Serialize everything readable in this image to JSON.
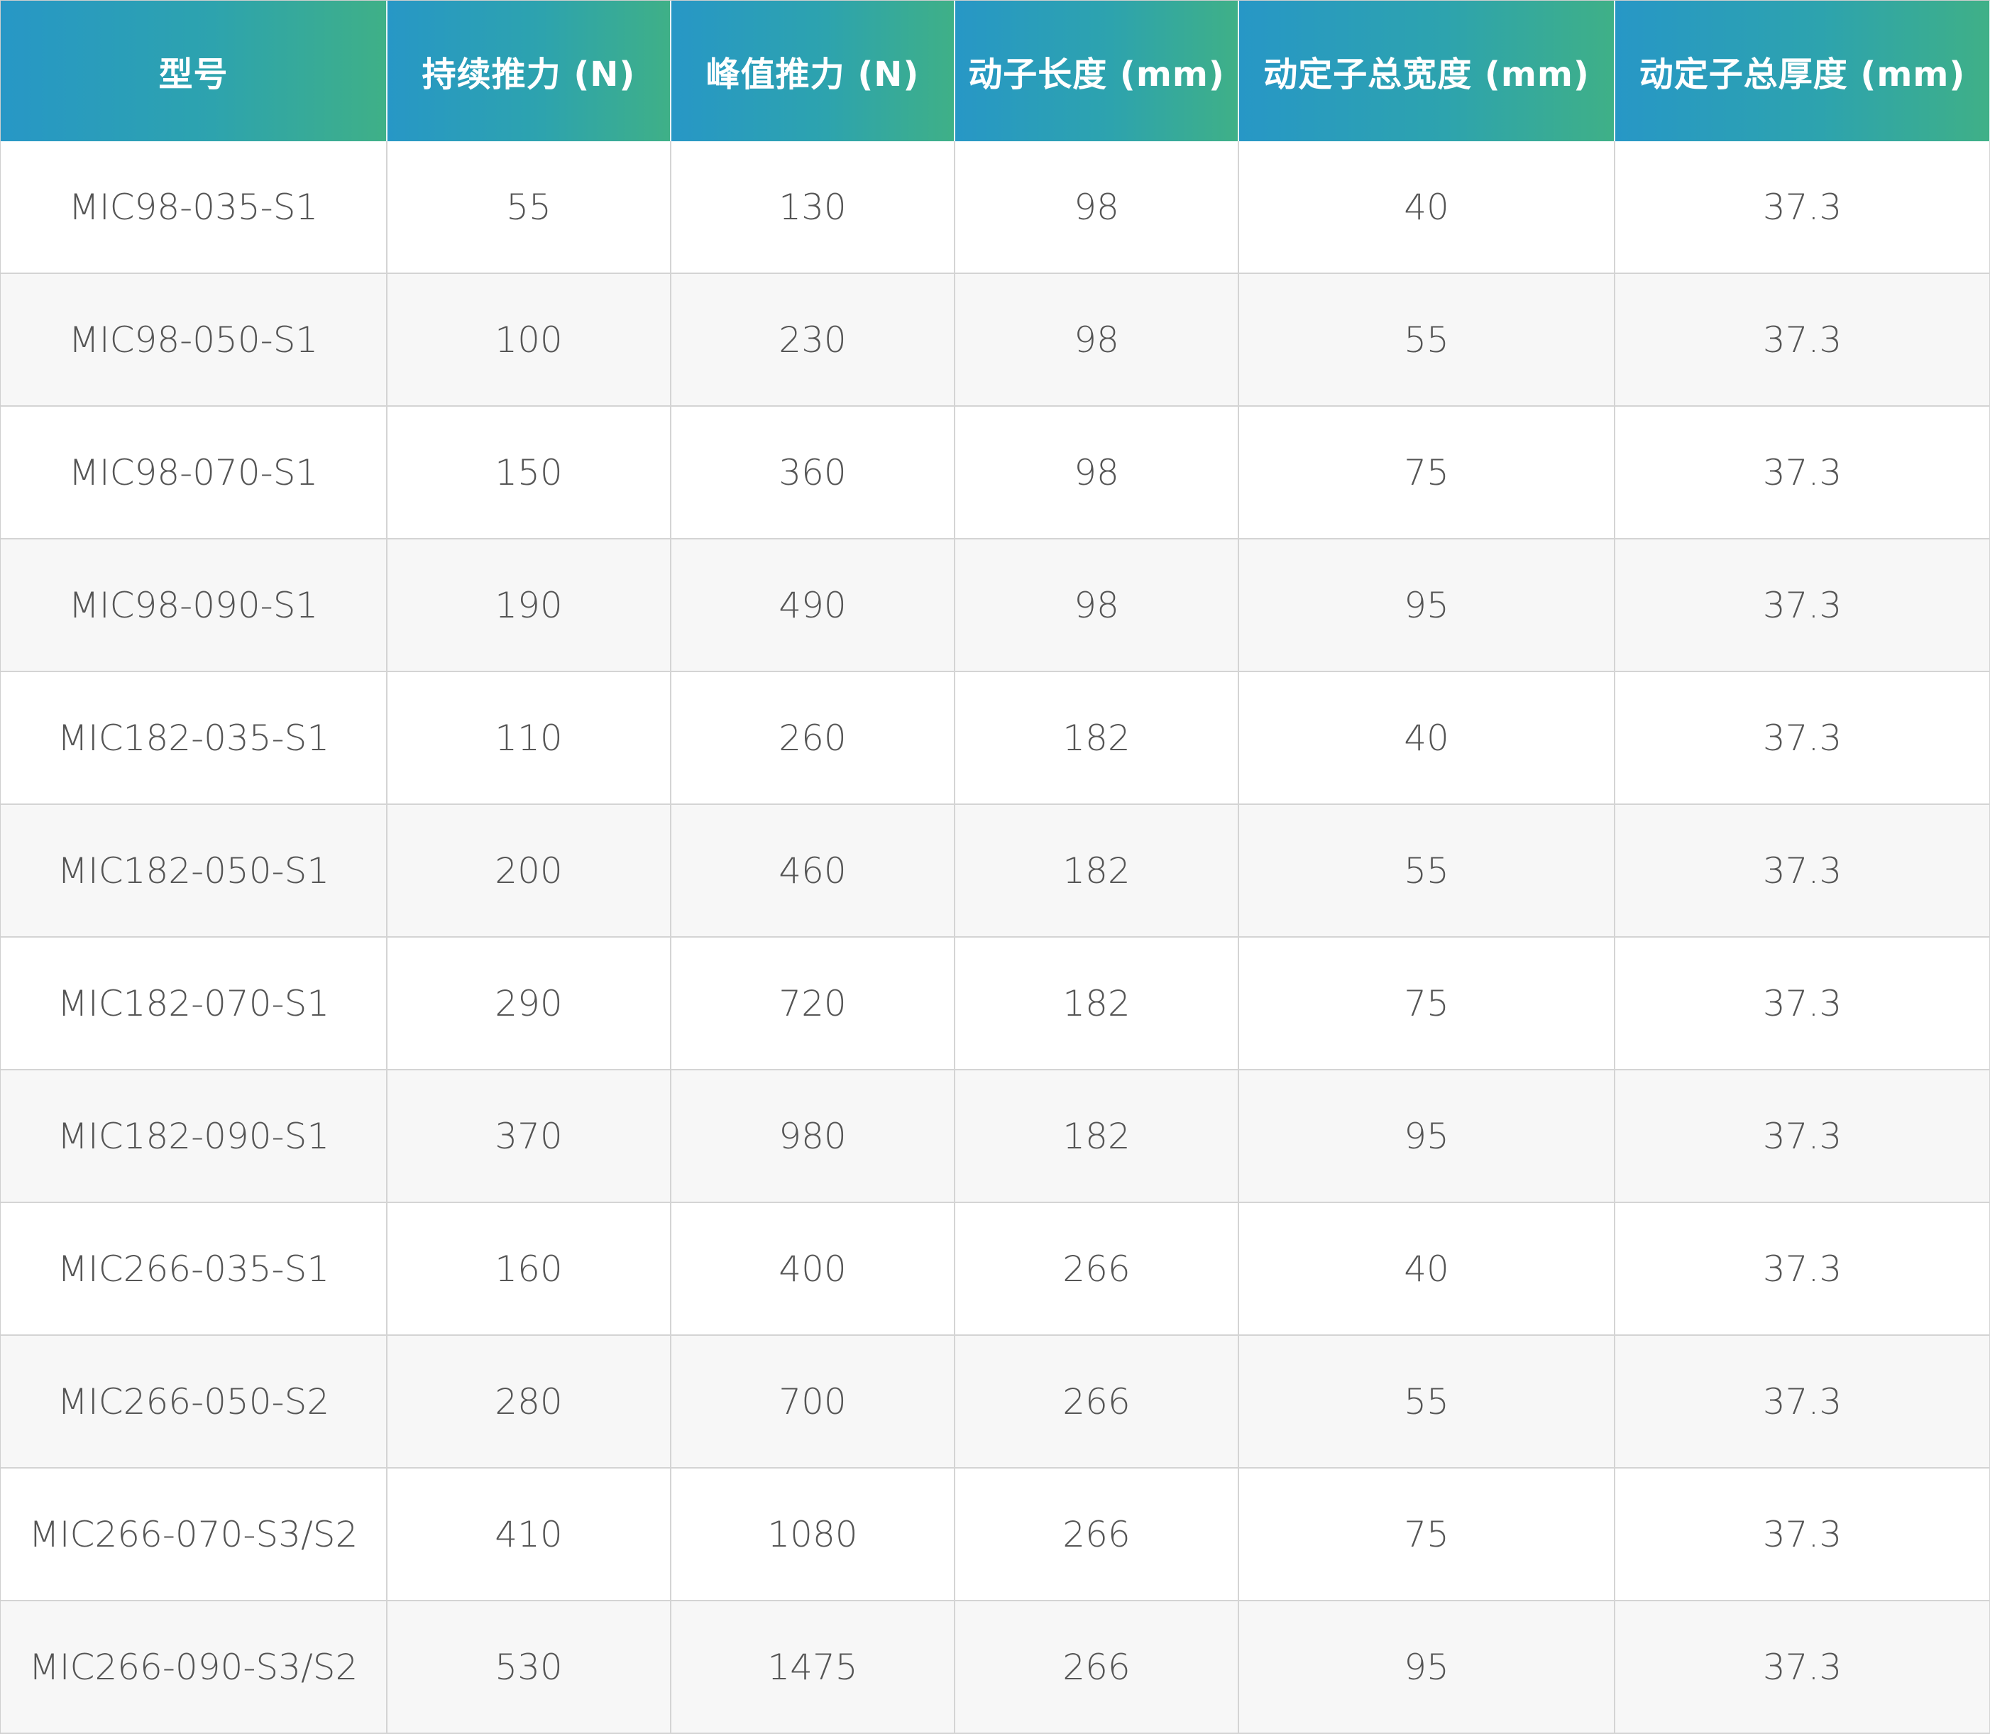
{
  "table": {
    "headers": [
      "型号",
      "持续推力 (N)",
      "峰值推力 (N)",
      "动子长度 (mm)",
      "动定子总宽度 (mm)",
      "动定子总厚度 (mm)"
    ],
    "rows": [
      [
        "MIC98-035-S1",
        "55",
        "130",
        "98",
        "40",
        "37.3"
      ],
      [
        "MIC98-050-S1",
        "100",
        "230",
        "98",
        "55",
        "37.3"
      ],
      [
        "MIC98-070-S1",
        "150",
        "360",
        "98",
        "75",
        "37.3"
      ],
      [
        "MIC98-090-S1",
        "190",
        "490",
        "98",
        "95",
        "37.3"
      ],
      [
        "MIC182-035-S1",
        "110",
        "260",
        "182",
        "40",
        "37.3"
      ],
      [
        "MIC182-050-S1",
        "200",
        "460",
        "182",
        "55",
        "37.3"
      ],
      [
        "MIC182-070-S1",
        "290",
        "720",
        "182",
        "75",
        "37.3"
      ],
      [
        "MIC182-090-S1",
        "370",
        "980",
        "182",
        "95",
        "37.3"
      ],
      [
        "MIC266-035-S1",
        "160",
        "400",
        "266",
        "40",
        "37.3"
      ],
      [
        "MIC266-050-S2",
        "280",
        "700",
        "266",
        "55",
        "37.3"
      ],
      [
        "MIC266-070-S3/S2",
        "410",
        "1080",
        "266",
        "75",
        "37.3"
      ],
      [
        "MIC266-090-S3/S2",
        "530",
        "1475",
        "266",
        "95",
        "37.3"
      ]
    ]
  },
  "colors": {
    "header_gradient_start": "#2797c6",
    "header_gradient_end": "#3fb087",
    "header_text": "#ffffff",
    "cell_text": "#555555",
    "row_alt_background": "#f7f7f7",
    "grid_line": "#d4d4d4"
  }
}
